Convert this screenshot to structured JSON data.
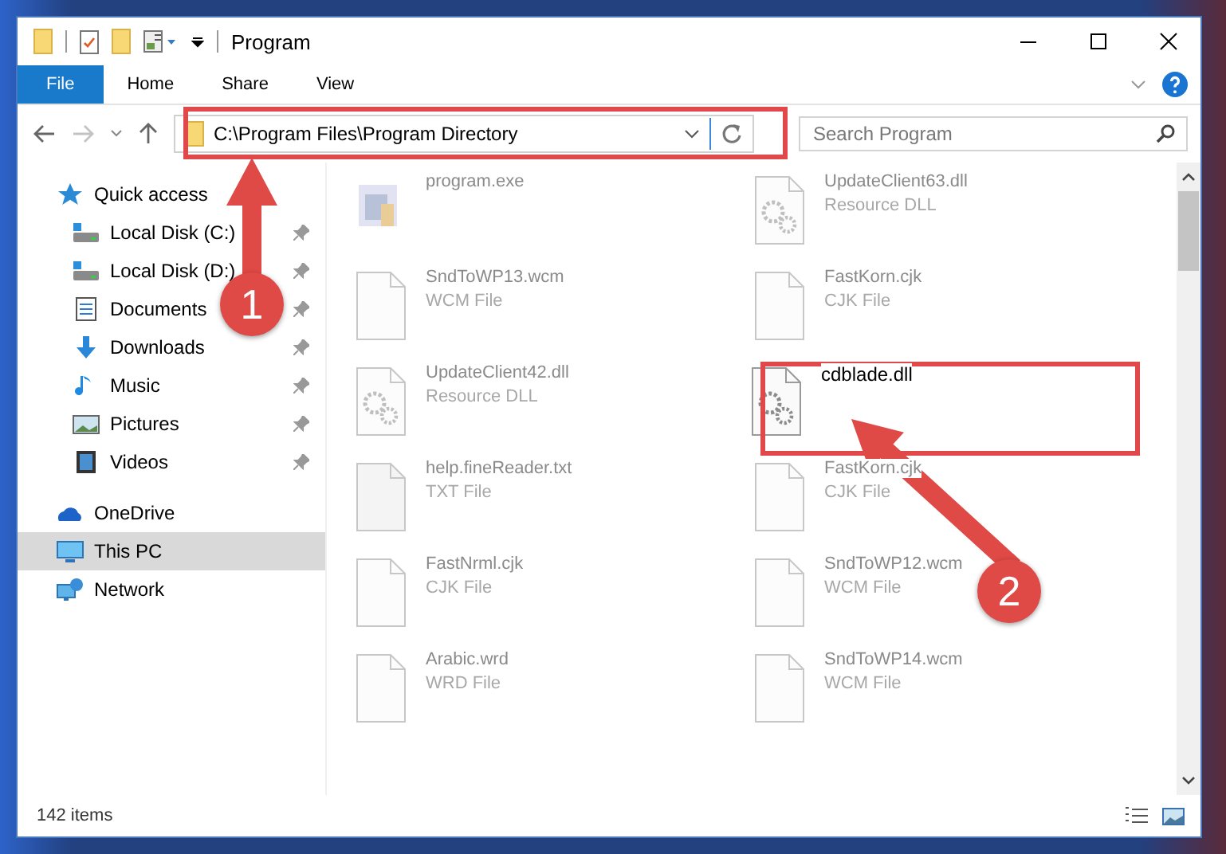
{
  "window": {
    "title": "Program"
  },
  "ribbon_tabs": [
    {
      "label": "File",
      "kind": "file"
    },
    {
      "label": "Home",
      "kind": "tab"
    },
    {
      "label": "Share",
      "kind": "tab"
    },
    {
      "label": "View",
      "kind": "tab"
    }
  ],
  "address_bar": {
    "path": "C:\\Program Files\\Program Directory"
  },
  "search": {
    "placeholder": "Search Program"
  },
  "sidebar": {
    "items": [
      {
        "label": "Quick access",
        "kind": "star",
        "selected": false,
        "children": [
          {
            "label": "Local Disk (C:)",
            "kind": "disk",
            "pinned": true,
            "selected": false
          },
          {
            "label": "Local Disk (D:)",
            "kind": "disk",
            "pinned": true,
            "selected": false
          },
          {
            "label": "Documents",
            "kind": "doc",
            "pinned": true,
            "selected": false
          },
          {
            "label": "Downloads",
            "kind": "download",
            "pinned": true,
            "selected": false
          },
          {
            "label": "Music",
            "kind": "music",
            "pinned": true,
            "selected": false
          },
          {
            "label": "Pictures",
            "kind": "pictures",
            "pinned": true,
            "selected": false
          },
          {
            "label": "Videos",
            "kind": "video",
            "pinned": true,
            "selected": false
          }
        ]
      },
      {
        "label": "OneDrive",
        "kind": "cloud",
        "selected": false
      },
      {
        "label": "This PC",
        "kind": "pc",
        "selected": true
      },
      {
        "label": "Network",
        "kind": "network",
        "selected": false
      }
    ]
  },
  "files": [
    {
      "name": "program.exe",
      "kind": "exe",
      "highlighted": false
    },
    {
      "name": "UpdateClient63.dll",
      "type": "Resource DLL",
      "kind": "dll",
      "highlighted": false
    },
    {
      "name": "SndToWP13.wcm",
      "type": "WCM File",
      "kind": "blank",
      "highlighted": false
    },
    {
      "name": "FastKorn.cjk",
      "type": "CJK File",
      "kind": "blank",
      "highlighted": false
    },
    {
      "name": "UpdateClient42.dll",
      "type": "Resource DLL",
      "kind": "dll",
      "highlighted": false
    },
    {
      "name": "cdblade.dll",
      "kind": "dll",
      "highlighted": true
    },
    {
      "name": "help.fineReader.txt",
      "type": "TXT File",
      "kind": "txt",
      "highlighted": false
    },
    {
      "name": "FastKorn.cjk",
      "type": "CJK File",
      "kind": "blank",
      "highlighted": false
    },
    {
      "name": "FastNrml.cjk",
      "type": "CJK File",
      "kind": "blank",
      "highlighted": false
    },
    {
      "name": "SndToWP12.wcm",
      "type": "WCM File",
      "kind": "blank",
      "highlighted": false
    },
    {
      "name": "Arabic.wrd",
      "type": "WRD File",
      "kind": "blank",
      "highlighted": false
    },
    {
      "name": "SndToWP14.wcm",
      "type": "WCM File",
      "kind": "blank",
      "highlighted": false
    }
  ],
  "status_bar": {
    "count": "142 items"
  },
  "annotations": [
    {
      "label": "1"
    },
    {
      "label": "2"
    }
  ]
}
